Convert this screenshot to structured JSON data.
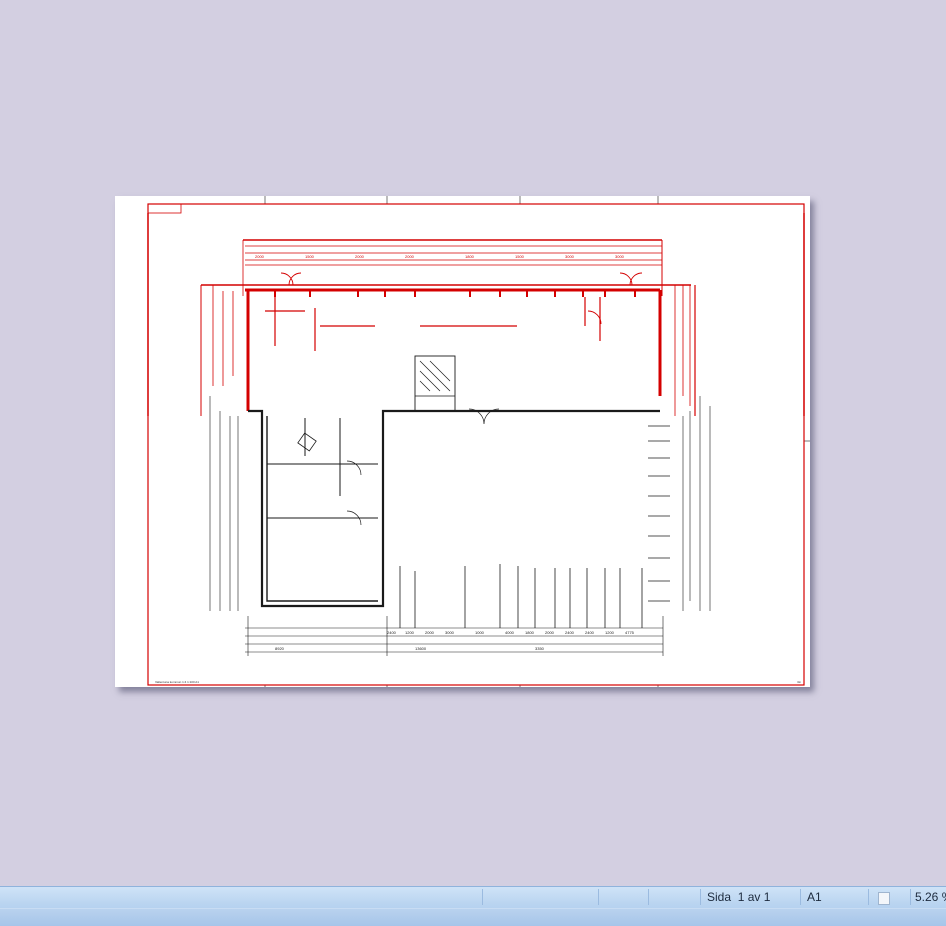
{
  "document": {
    "sheet_title_block_left": "Vallentuna kommun 1:4 1:100 A1",
    "sheet_corner_text": "ritn"
  },
  "drawing": {
    "dimensions_top_red": [
      "2000",
      "1500",
      "2000",
      "2000",
      "1800",
      "1500",
      "3000",
      "3000"
    ],
    "dimensions_bottom_black": [
      "2400",
      "1200",
      "2000",
      "3000",
      "1000",
      "4000",
      "1800",
      "2000",
      "2400",
      "2400",
      "1200",
      "4775"
    ],
    "dimensions_bottom_total": [
      "8920",
      "13600",
      "3350"
    ],
    "line_color_existing": "#1a1a1a",
    "line_color_new": "#d40000"
  },
  "status_bar": {
    "page_label": "Sida",
    "page_value": "1 av 1",
    "paper_size": "A1",
    "zoom": "5.26 %"
  },
  "colors": {
    "background": "#d3cfe1",
    "status_bar": "#b9d4f0",
    "drawing_red": "#d40000"
  }
}
